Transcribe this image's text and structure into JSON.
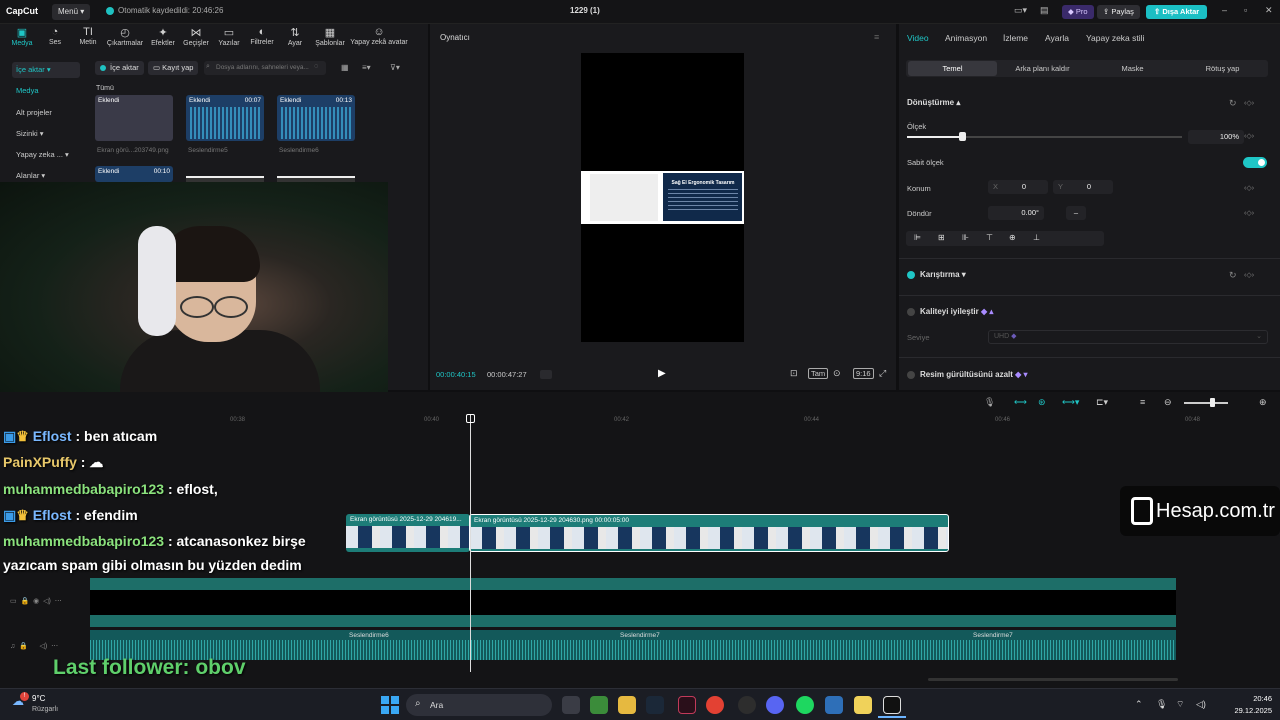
{
  "app": {
    "logo": "CapCut",
    "menu_label": "Menü",
    "save_status": "Otomatik kaydedildi: 20:46:26",
    "project_title": "1229 (1)",
    "pro_label": "Pro",
    "share_label": "Paylaş",
    "export_label": "Dışa Aktar"
  },
  "toolbar": {
    "items": [
      {
        "label": "Medya",
        "icon": "media-icon"
      },
      {
        "label": "Ses",
        "icon": "audio-icon"
      },
      {
        "label": "Metin",
        "icon": "text-icon"
      },
      {
        "label": "Çıkartmalar",
        "icon": "sticker-icon"
      },
      {
        "label": "Efektler",
        "icon": "effects-icon"
      },
      {
        "label": "Geçişler",
        "icon": "transitions-icon"
      },
      {
        "label": "Yazılar",
        "icon": "captions-icon"
      },
      {
        "label": "Filtreler",
        "icon": "filters-icon"
      },
      {
        "label": "Ayar",
        "icon": "adjust-icon"
      },
      {
        "label": "Şablonlar",
        "icon": "templates-icon"
      },
      {
        "label": "Yapay zekâ avatar",
        "icon": "ai-avatar-icon"
      }
    ]
  },
  "sidebar": {
    "items": [
      {
        "label": "İçe aktar ▾"
      },
      {
        "label": "Medya"
      },
      {
        "label": "Alt projeler"
      },
      {
        "label": "Sizinki ▾"
      },
      {
        "label": "Yapay zeka ... ▾"
      },
      {
        "label": "Alanlar ▾"
      }
    ]
  },
  "media": {
    "import_label": "İçe aktar",
    "record_label": "Kayıt yap",
    "search_placeholder": "Dosya adlarını, sahneleri veya...",
    "all_label": "Tümü",
    "items": [
      {
        "badge": "Eklendi",
        "duration": "",
        "caption": "Ekran görü...203749.png"
      },
      {
        "badge": "Eklendi",
        "duration": "00:07",
        "caption": "Seslendirme5"
      },
      {
        "badge": "Eklendi",
        "duration": "00:13",
        "caption": "Seslendirme6"
      },
      {
        "badge": "Eklendi",
        "duration": "00:10",
        "caption": ""
      }
    ]
  },
  "player": {
    "title": "Oynatıcı",
    "slide_title": "Sağ El Ergonomik Tasarım",
    "current_time": "00:00:40:15",
    "total_time": "00:00:47:27",
    "ratio_label": "9:16",
    "quality_label": "Tam"
  },
  "props": {
    "tabs": [
      "Video",
      "Animasyon",
      "İzleme",
      "Ayarla",
      "Yapay zeka stili"
    ],
    "subtabs": [
      "Temel",
      "Arka planı kaldır",
      "Maske",
      "Rötuş yap"
    ],
    "transform_title": "Dönüştürme ▴",
    "scale_label": "Ölçek",
    "scale_value": "100%",
    "scale_fraction": 0.2,
    "uniform_scale_label": "Sabit ölçek",
    "position_label": "Konum",
    "pos_x_label": "X",
    "pos_x_value": "0",
    "pos_y_label": "Y",
    "pos_y_value": "0",
    "rotate_label": "Döndür",
    "rotate_value": "0.00°",
    "blend_label": "Karıştırma ▾",
    "enhance_label": "Kaliteyi iyileştir",
    "level_label": "Seviye",
    "level_value": "UHD",
    "denoise_label": "Resim gürültüsünü azalt"
  },
  "timeline": {
    "ticks": [
      "00:38",
      "00:40",
      "00:42",
      "00:44",
      "00:46",
      "00:48"
    ],
    "clip1_label": "Ekran görüntüsü 2025-12-29 204619...",
    "clip2_label": "Ekran görüntüsü 2025-12-29 204630.png  00:00:05:00",
    "audio_labels": [
      "Seslendirme6",
      "Seslendirme7",
      "Seslendirme7"
    ]
  },
  "chat": {
    "lines": [
      {
        "name": "Eflost",
        "text": ": ben atıcam"
      },
      {
        "name": "PainXPuffy",
        "text": ":"
      },
      {
        "name": "muhammedbabapiro123",
        "text": ": eflost,"
      },
      {
        "name": "Eflost",
        "text": ": efendim"
      },
      {
        "name": "muhammedbabapiro123",
        "text": ": atcanasonkez birşe"
      }
    ],
    "continuation": "yazıcam spam gibi olmasın bu yüzden dedim",
    "last_follower": "Last follower: obov"
  },
  "watermark": "Hesap.com.tr",
  "taskbar": {
    "weather_temp": "9°C",
    "weather_desc": "Rüzgarlı",
    "search_label": "Ara",
    "time": "20:46",
    "date": "29.12.2025"
  }
}
